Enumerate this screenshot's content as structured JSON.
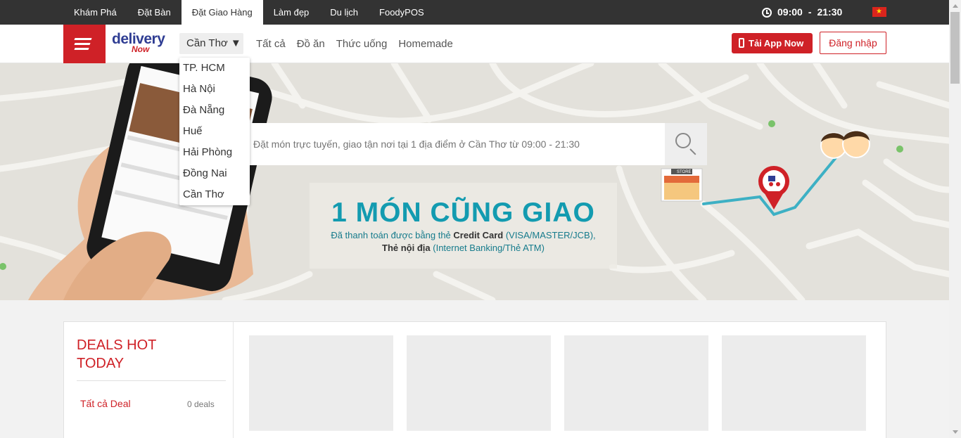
{
  "topnav": {
    "items": [
      {
        "label": "Khám Phá"
      },
      {
        "label": "Đặt Bàn"
      },
      {
        "label": "Đặt Giao Hàng",
        "active": true
      },
      {
        "label": "Làm đẹp"
      },
      {
        "label": "Du lịch"
      },
      {
        "label": "FoodyPOS"
      }
    ],
    "hours_open": "09:00",
    "hours_sep": "-",
    "hours_close": "21:30",
    "flag": "vietnam-flag-icon"
  },
  "header": {
    "logo_line1": "delivery",
    "logo_line2": "Now",
    "city_selected": "Cần Thơ ▼",
    "categories": [
      "Tất cả",
      "Đồ ăn",
      "Thức uống",
      "Homemade"
    ],
    "app_button": "Tải App Now",
    "login_button": "Đăng nhập",
    "brand_color": "#cf2127"
  },
  "city_dropdown": {
    "options": [
      "TP. HCM",
      "Hà Nội",
      "Đà Nẵng",
      "Huế",
      "Hải Phòng",
      "Đồng Nai",
      "Cần Thơ"
    ]
  },
  "hero": {
    "search_placeholder": "Đặt món trực tuyến, giao tận nơi tại 1 địa điểm ở Cần Thơ từ 09:00 - 21:30",
    "promo_heading": "1 MÓN CŨNG GIAO",
    "promo_line1_pre": "Đã thanh toán được bằng thẻ ",
    "promo_line1_bold": "Credit Card",
    "promo_line1_post": " (VISA/MASTER/JCB),",
    "promo_line2_bold": "Thẻ nội địa",
    "promo_line2_post": " (Internet Banking/Thẻ ATM)",
    "accent_color": "#139bb0"
  },
  "deals": {
    "title": "DEALS HOT TODAY",
    "all_label": "Tất cả Deal",
    "count_label": "0 deals"
  }
}
